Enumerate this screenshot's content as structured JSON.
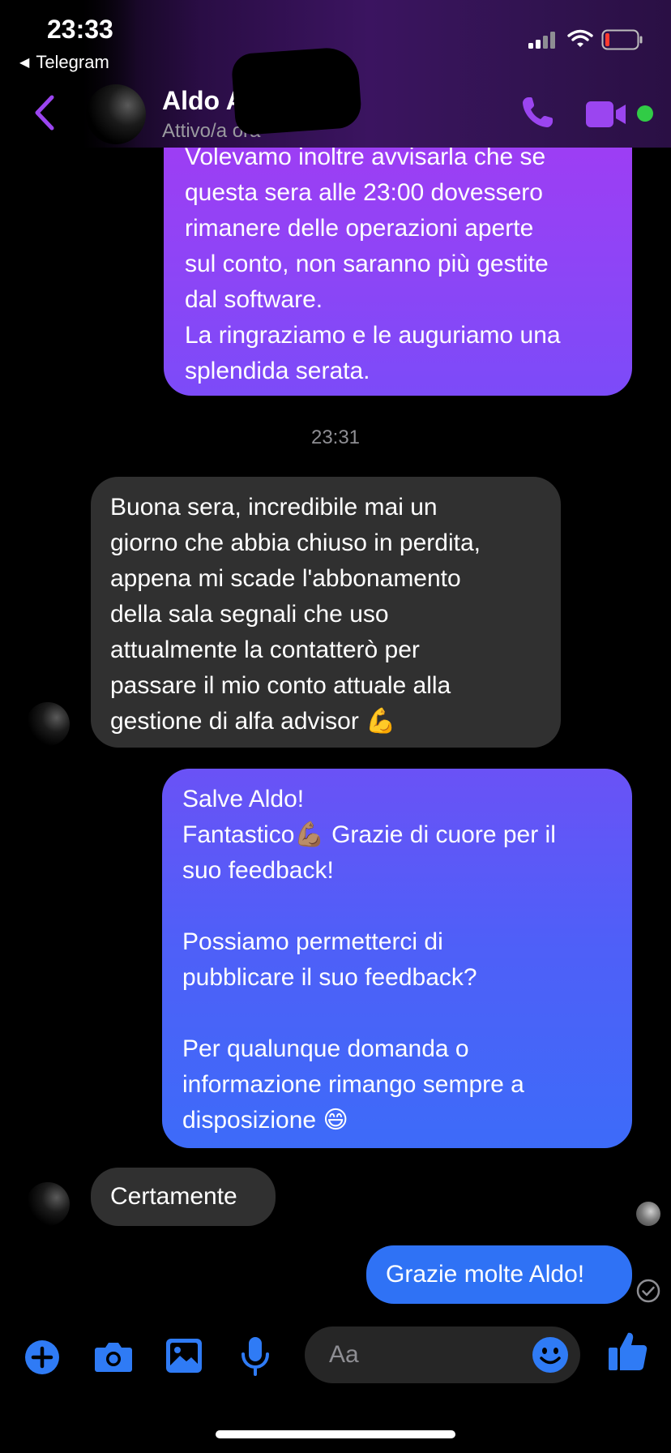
{
  "status_bar": {
    "time": "23:33",
    "back_app": "Telegram"
  },
  "header": {
    "contact_name": "Aldo A",
    "presence": "Attivo/a ora"
  },
  "messages": [
    {
      "id": "m1",
      "direction": "out",
      "text": "Volevamo inoltre avvisarla che se\nquesta sera alle 23:00 dovessero\nrimanere delle operazioni aperte\nsul conto, non saranno più gestite\ndal software.\nLa ringraziamo e le auguriamo una\nsplendida serata."
    },
    {
      "id": "ts1",
      "type": "timestamp",
      "text": "23:31"
    },
    {
      "id": "m2",
      "direction": "in",
      "text": "Buona sera, incredibile mai un\ngiorno che abbia  chiuso in perdita,\nappena mi scade l'abbonamento\ndella sala segnali  che uso\nattualmente la contatterò per\npassare il mio conto attuale alla\ngestione di alfa advisor 💪"
    },
    {
      "id": "m3",
      "direction": "out",
      "text": "Salve Aldo!\nFantastico💪🏽 Grazie di cuore per il\nsuo feedback!\n\nPossiamo permetterci di\npubblicare il suo feedback?\n\nPer qualunque domanda o\ninformazione rimango sempre a\ndisposizione 😄"
    },
    {
      "id": "m4",
      "direction": "in",
      "text": "Certamente"
    },
    {
      "id": "m5",
      "direction": "out",
      "text": "Grazie molte Aldo!"
    }
  ],
  "composer": {
    "placeholder": "Aa"
  },
  "icons": [
    "back-icon",
    "phone-icon",
    "video-camera-icon",
    "add-icon",
    "camera-icon",
    "gallery-icon",
    "microphone-icon",
    "emoji-icon",
    "like-icon",
    "delivered-check-icon"
  ],
  "colors": {
    "accent_purple": "#a13cf3",
    "accent_blue": "#2f72f5",
    "incoming_bubble": "#303030",
    "online_dot": "#31cc46"
  }
}
